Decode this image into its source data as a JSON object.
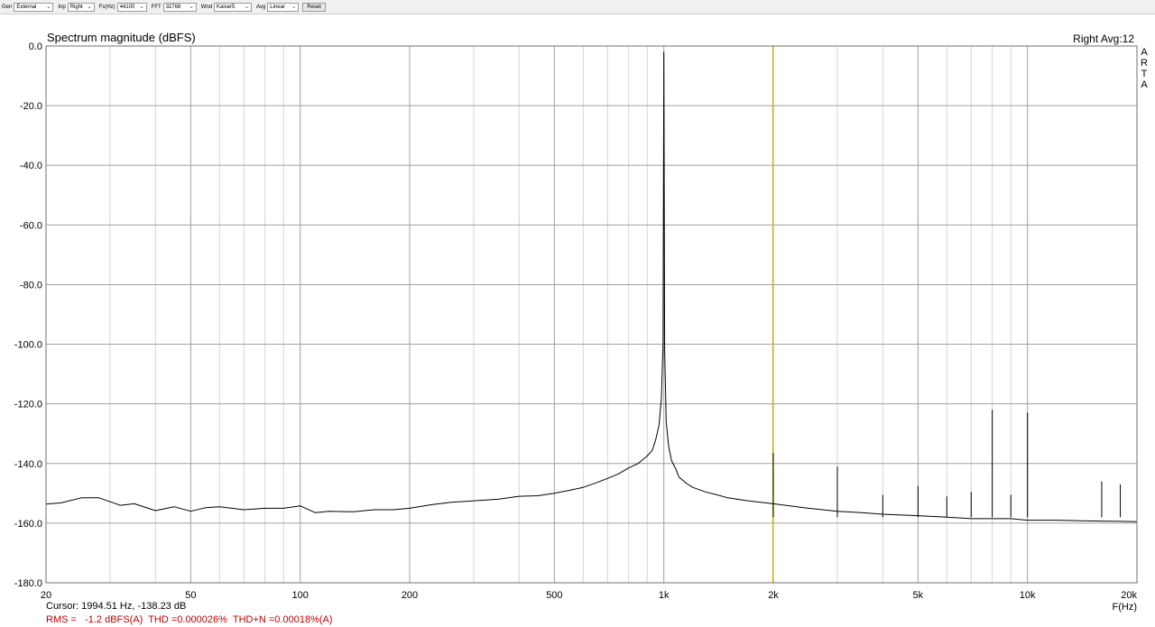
{
  "toolbar": {
    "gen": {
      "label": "Gen",
      "value": "External"
    },
    "inp": {
      "label": "Inp",
      "value": "Right"
    },
    "fs": {
      "label": "Fs(Hz)",
      "value": "44100"
    },
    "fft": {
      "label": "FFT",
      "value": "32768"
    },
    "wnd": {
      "label": "Wnd",
      "value": "Kaiser5"
    },
    "avg": {
      "label": "Avg",
      "value": "Linear"
    },
    "reset_label": "Reset"
  },
  "channel_label": "Right  Avg:12",
  "arta_letters": [
    "A",
    "R",
    "T",
    "A"
  ],
  "cursor_text": "Cursor: 1994.51 Hz, -138.23 dB",
  "metrics_text": "RMS =   -1.2 dBFS(A)  THD =0.000026%  THD+N =0.00018%(A)",
  "colors": {
    "trace": "#000000",
    "grid_major": "#a0a0a0",
    "grid_minor": "#d4d4d4",
    "cursor": "#c8b400",
    "metrics": "#c00000"
  },
  "chart_data": {
    "type": "line",
    "title": "Spectrum magnitude (dBFS)",
    "xlabel": "F(Hz)",
    "ylabel": "",
    "x_scale": "log",
    "xlim": [
      20,
      20000
    ],
    "ylim": [
      -180,
      0
    ],
    "grid": true,
    "x_ticks": [
      {
        "value": 20,
        "label": "20"
      },
      {
        "value": 50,
        "label": "50"
      },
      {
        "value": 100,
        "label": "100"
      },
      {
        "value": 200,
        "label": "200"
      },
      {
        "value": 500,
        "label": "500"
      },
      {
        "value": 1000,
        "label": "1k"
      },
      {
        "value": 2000,
        "label": "2k"
      },
      {
        "value": 5000,
        "label": "5k"
      },
      {
        "value": 10000,
        "label": "10k"
      },
      {
        "value": 20000,
        "label": "20k"
      }
    ],
    "y_ticks": [
      {
        "value": 0,
        "label": "0.0"
      },
      {
        "value": -20,
        "label": "-20.0"
      },
      {
        "value": -40,
        "label": "-40.0"
      },
      {
        "value": -60,
        "label": "-60.0"
      },
      {
        "value": -80,
        "label": "-80.0"
      },
      {
        "value": -100,
        "label": "-100.0"
      },
      {
        "value": -120,
        "label": "-120.0"
      },
      {
        "value": -140,
        "label": "-140.0"
      },
      {
        "value": -160,
        "label": "-160.0"
      },
      {
        "value": -180,
        "label": "-180.0"
      }
    ],
    "cursor_frequency": 1994.51,
    "series": [
      {
        "x": [
          20,
          22,
          25,
          28,
          32,
          35,
          40,
          45,
          50,
          55,
          60,
          70,
          80,
          90,
          100,
          110,
          120,
          140,
          160,
          180,
          200,
          230,
          260,
          300,
          350,
          400,
          450,
          500,
          550,
          600,
          650,
          700,
          750,
          800,
          850,
          900,
          930,
          950,
          970,
          985,
          995,
          1000,
          1005,
          1015,
          1030,
          1050,
          1080,
          1100,
          1150,
          1200,
          1300,
          1400,
          1500,
          1700,
          2000,
          2500,
          3000,
          3500,
          4000,
          5000,
          6000,
          7000,
          8000,
          9000,
          10000,
          12000,
          14000,
          16000,
          18000,
          20000
        ],
        "y": [
          -153.6,
          -153.2,
          -151.5,
          -151.5,
          -154,
          -153.5,
          -155.8,
          -154.5,
          -156,
          -154.8,
          -154.5,
          -155.5,
          -155,
          -155,
          -154.2,
          -156.5,
          -156,
          -156.2,
          -155.5,
          -155.5,
          -155,
          -153.8,
          -153,
          -152.5,
          -152,
          -151,
          -150.8,
          -150,
          -149,
          -148,
          -146.5,
          -145,
          -143.5,
          -141.5,
          -140,
          -137.5,
          -135.5,
          -132,
          -127,
          -118,
          -100,
          -2,
          -102,
          -126,
          -134,
          -139,
          -142,
          -144.5,
          -146.5,
          -148,
          -149.5,
          -150.5,
          -151.5,
          -152.5,
          -153.5,
          -155,
          -156,
          -156.5,
          -157,
          -157.5,
          -158,
          -158.5,
          -158.5,
          -158.5,
          -159,
          -159,
          -159.2,
          -159.3,
          -159.4,
          -159.5
        ]
      }
    ],
    "spurs": [
      {
        "x": 2000,
        "y": -136.5
      },
      {
        "x": 3000,
        "y": -141
      },
      {
        "x": 4000,
        "y": -150.5
      },
      {
        "x": 5000,
        "y": -147.5
      },
      {
        "x": 6000,
        "y": -151
      },
      {
        "x": 7000,
        "y": -149.5
      },
      {
        "x": 8000,
        "y": -122
      },
      {
        "x": 9000,
        "y": -150.5
      },
      {
        "x": 10000,
        "y": -123
      },
      {
        "x": 16000,
        "y": -146
      },
      {
        "x": 18000,
        "y": -147
      }
    ]
  }
}
